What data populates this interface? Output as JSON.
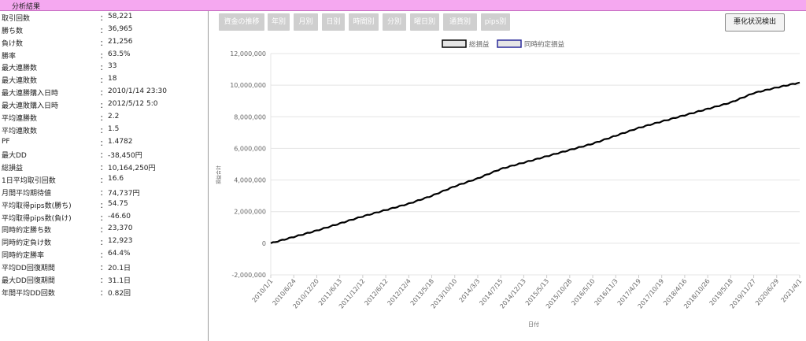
{
  "header": {
    "title": "分析結果"
  },
  "stats": [
    {
      "label": "取引回数",
      "value": "58,221"
    },
    {
      "label": "勝ち数",
      "value": "36,965"
    },
    {
      "label": "負け数",
      "value": "21,256"
    },
    {
      "label": "勝率",
      "value": "63.5%"
    },
    {
      "label": "最大連勝数",
      "value": "33"
    },
    {
      "label": "最大連敗数",
      "value": "18"
    },
    {
      "label": "最大連勝購入日時",
      "value": "2010/1/14 23:30"
    },
    {
      "label": "最大連敗購入日時",
      "value": "2012/5/12 5:0"
    },
    {
      "label": "平均連勝数",
      "value": "2.2"
    },
    {
      "label": "平均連敗数",
      "value": "1.5"
    },
    {
      "label": "PF",
      "value": "1.4782"
    },
    {
      "label": "最大DD",
      "value": "-38,450円"
    },
    {
      "label": "総損益",
      "value": "10,164,250円"
    },
    {
      "label": "1日平均取引回数",
      "value": "16.6"
    },
    {
      "label": "月間平均期待値",
      "value": "74,737円"
    },
    {
      "label": "平均取得pips数(勝ち)",
      "value": "54.75"
    },
    {
      "label": "平均取得pips数(負け)",
      "value": "-46.60"
    },
    {
      "label": "同時約定勝ち数",
      "value": "23,370"
    },
    {
      "label": "同時約定負け数",
      "value": "12,923"
    },
    {
      "label": "同時約定勝率",
      "value": "64.4%"
    },
    {
      "label": "平均DD回復期間",
      "value": "20.1日"
    },
    {
      "label": "最大DD回復期間",
      "value": "31.1日"
    },
    {
      "label": "年間平均DD回数",
      "value": "0.82回"
    }
  ],
  "stats_separator": "：",
  "tabs": [
    "資金の推移",
    "年別",
    "月別",
    "日別",
    "時間別",
    "分別",
    "曜日別",
    "通貨別",
    "pips別"
  ],
  "detect_button": "悪化状況検出",
  "chart_data": {
    "type": "line",
    "xlabel": "日付",
    "ylabel": "損益合計",
    "ylim": [
      -2000000,
      12000000
    ],
    "y_ticks": [
      "-2,000,000",
      "0",
      "2,000,000",
      "4,000,000",
      "6,000,000",
      "8,000,000",
      "10,000,000",
      "12,000,000"
    ],
    "x_ticks": [
      "2010/1/1",
      "2010/6/24",
      "2010/12/20",
      "2011/6/13",
      "2011/12/12",
      "2012/6/12",
      "2012/12/4",
      "2013/5/18",
      "2013/10/10",
      "2014/3/3",
      "2014/7/15",
      "2014/12/13",
      "2015/5/13",
      "2015/10/28",
      "2016/5/10",
      "2016/11/3",
      "2017/4/19",
      "2017/10/19",
      "2018/4/16",
      "2018/10/26",
      "2019/5/18",
      "2019/11/27",
      "2020/6/29",
      "2021/4/1"
    ],
    "legend": [
      "総損益",
      "同時約定損益"
    ],
    "legend_placement": "top",
    "grid": true,
    "series": [
      {
        "name": "総損益",
        "color": "#000000",
        "values": [
          0,
          400000,
          800000,
          1250000,
          1700000,
          2100000,
          2500000,
          3000000,
          3600000,
          4100000,
          4700000,
          5100000,
          5500000,
          5900000,
          6300000,
          6800000,
          7300000,
          7700000,
          8100000,
          8500000,
          8900000,
          9500000,
          9850000,
          10164250
        ]
      }
    ]
  }
}
